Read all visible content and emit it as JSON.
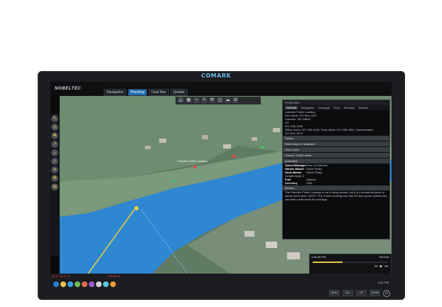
{
  "device": {
    "brand": "COMARK",
    "hw_buttons": [
      "MENU",
      "SEL",
      "UP",
      "DOWN"
    ],
    "power_icon": "power-icon"
  },
  "app": {
    "logo": "NOBELTEC",
    "tabs": [
      {
        "label": "Navigation"
      },
      {
        "label": "Planning"
      },
      {
        "label": "Dual Nav"
      },
      {
        "label": "Update"
      }
    ]
  },
  "toolbar": {
    "icons": [
      "anchor-icon",
      "chart-icon",
      "route-icon",
      "tools-icon",
      "wrench-icon",
      "layers-icon",
      "weather-icon",
      "settings-icon"
    ]
  },
  "leftbar": {
    "icons": [
      "pencil-icon",
      "target-icon",
      "mark-icon",
      "route-icon",
      "measure-icon",
      "zoom-icon",
      "circle-icon",
      "pan-icon",
      "layer-icon"
    ]
  },
  "map": {
    "labels": [
      {
        "text": "Camden Public Landing"
      }
    ]
  },
  "properties": {
    "title": "Properties",
    "tabs": [
      "General",
      "Navigation",
      "Dockage",
      "Fuel",
      "Reviews",
      "Review"
    ],
    "address": [
      "Camden Public Landing",
      "Elm Street, PO Box 1207",
      "Camden, ME 04843",
      "US",
      "207-236-7969",
      "Office hours: 207-236-4118, Town office: 207-236-3353, Harbormaster",
      "207-691-1674"
    ],
    "sections": [
      {
        "label": "Harbor"
      },
      {
        "label": "Boat ramps or seaplane"
      },
      {
        "label": "Year round"
      },
      {
        "label": "Checks, Credit cards"
      },
      {
        "label": "Amenities"
      }
    ],
    "kv": [
      {
        "k": "Owner/Manager",
        "v": "Town of Camden"
      },
      {
        "k": "Harbor Master",
        "v": "Steve Pixley"
      },
      {
        "k": "Dock Master",
        "v": "Steve Pixley"
      }
    ],
    "length_depth": "Length/depth 0",
    "fuel": [
      {
        "k": "Fuel",
        "v": "Gallons"
      },
      {
        "k": "Currency",
        "v": "USD"
      }
    ],
    "review_heading": "Review",
    "review": "The Camden Public Landing is not a fixing marina, but it is a wonderful place to spend some time. NOTE: The Public Landing now has 30 amp power outlets and can take credit cards for dockage."
  },
  "media": {
    "time": "4:45:38 PM",
    "date": "7/5/2011",
    "progress": 0.4
  },
  "status": {
    "left": "11 23 10.47 N",
    "mid": "4 45 38 W"
  },
  "taskbar": {
    "tray": "4:51 PM",
    "icons": [
      "start-icon",
      "folder-icon",
      "browser-icon",
      "chart-icon",
      "mail-icon",
      "media-icon",
      "clock-icon",
      "weather-icon",
      "app-icon"
    ]
  }
}
